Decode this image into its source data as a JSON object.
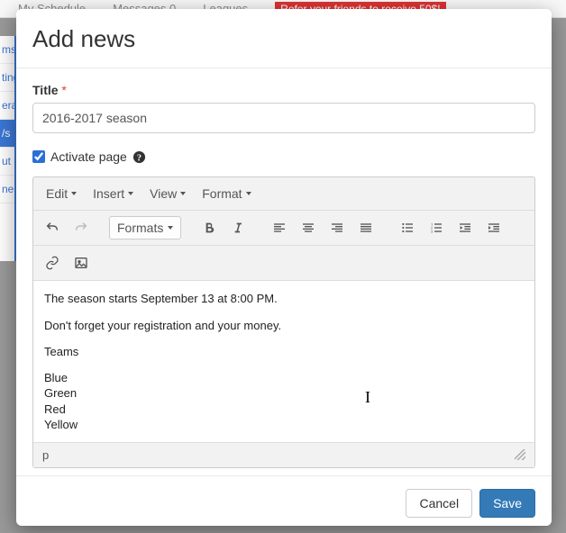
{
  "backdrop": {
    "nav": [
      "My Schedule",
      "Messages",
      "Leagues"
    ],
    "nav_badge": "0",
    "banner": "Refer your friends to receive 50$!",
    "sidebar": [
      "ms",
      "ting",
      "era",
      "/s",
      "ut",
      "ner"
    ]
  },
  "modal": {
    "title": "Add news"
  },
  "form": {
    "title_label": "Title",
    "required_mark": "*",
    "title_value": "2016-2017 season",
    "activate_label": "Activate page",
    "activate_checked": true
  },
  "editor": {
    "menu": {
      "edit": "Edit",
      "insert": "Insert",
      "view": "View",
      "format": "Format"
    },
    "toolbar": {
      "formats_label": "Formats"
    },
    "content": {
      "p1": "The season starts September 13 at 8:00 PM.",
      "p2": "Don't forget your registration and your money.",
      "p3": "Teams",
      "teams": [
        "Blue",
        "Green",
        "Red",
        "Yellow"
      ]
    },
    "status_path": "p"
  },
  "footer": {
    "cancel": "Cancel",
    "save": "Save"
  }
}
